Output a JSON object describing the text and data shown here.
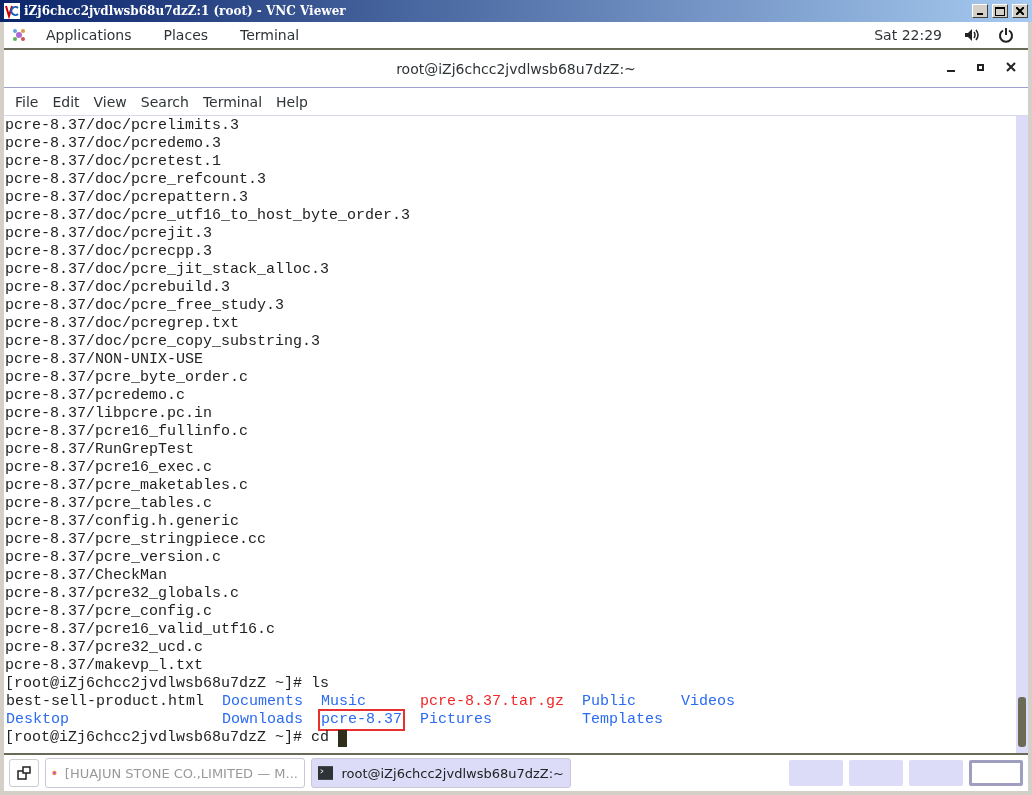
{
  "vnc_window": {
    "title": "iZj6chcc2jvdlwsb68u7dzZ:1 (root) - VNC Viewer"
  },
  "top_bar": {
    "menus": [
      "Applications",
      "Places",
      "Terminal"
    ],
    "clock": "Sat 22:29"
  },
  "terminal_window": {
    "title": "root@iZj6chcc2jvdlwsb68u7dzZ:~"
  },
  "menu_bar": [
    "File",
    "Edit",
    "View",
    "Search",
    "Terminal",
    "Help"
  ],
  "output_lines": [
    "pcre-8.37/doc/pcrelimits.3",
    "pcre-8.37/doc/pcredemo.3",
    "pcre-8.37/doc/pcretest.1",
    "pcre-8.37/doc/pcre_refcount.3",
    "pcre-8.37/doc/pcrepattern.3",
    "pcre-8.37/doc/pcre_utf16_to_host_byte_order.3",
    "pcre-8.37/doc/pcrejit.3",
    "pcre-8.37/doc/pcrecpp.3",
    "pcre-8.37/doc/pcre_jit_stack_alloc.3",
    "pcre-8.37/doc/pcrebuild.3",
    "pcre-8.37/doc/pcre_free_study.3",
    "pcre-8.37/doc/pcregrep.txt",
    "pcre-8.37/doc/pcre_copy_substring.3",
    "pcre-8.37/NON-UNIX-USE",
    "pcre-8.37/pcre_byte_order.c",
    "pcre-8.37/pcredemo.c",
    "pcre-8.37/libpcre.pc.in",
    "pcre-8.37/pcre16_fullinfo.c",
    "pcre-8.37/RunGrepTest",
    "pcre-8.37/pcre16_exec.c",
    "pcre-8.37/pcre_maketables.c",
    "pcre-8.37/pcre_tables.c",
    "pcre-8.37/config.h.generic",
    "pcre-8.37/pcre_stringpiece.cc",
    "pcre-8.37/pcre_version.c",
    "pcre-8.37/CheckMan",
    "pcre-8.37/pcre32_globals.c",
    "pcre-8.37/pcre_config.c",
    "pcre-8.37/pcre16_valid_utf16.c",
    "pcre-8.37/pcre32_ucd.c",
    "pcre-8.37/makevp_l.txt"
  ],
  "prompt_ls": "[root@iZj6chcc2jvdlwsb68u7dzZ ~]# ls",
  "ls_columns": [
    {
      "entries": [
        {
          "name": "best-sell-product.html",
          "kind": "file",
          "highlighted": false
        },
        {
          "name": "Desktop",
          "kind": "dir",
          "highlighted": false
        }
      ]
    },
    {
      "entries": [
        {
          "name": "Documents",
          "kind": "dir",
          "highlighted": false
        },
        {
          "name": "Downloads",
          "kind": "dir",
          "highlighted": false
        }
      ]
    },
    {
      "entries": [
        {
          "name": "Music",
          "kind": "dir",
          "highlighted": false
        },
        {
          "name": "pcre-8.37",
          "kind": "dir",
          "highlighted": true
        }
      ]
    },
    {
      "entries": [
        {
          "name": "pcre-8.37.tar.gz",
          "kind": "archive",
          "highlighted": false
        },
        {
          "name": "Pictures",
          "kind": "dir",
          "highlighted": false
        }
      ]
    },
    {
      "entries": [
        {
          "name": "Public",
          "kind": "dir",
          "highlighted": false
        },
        {
          "name": "Templates",
          "kind": "dir",
          "highlighted": false
        }
      ]
    },
    {
      "entries": [
        {
          "name": "Videos",
          "kind": "dir",
          "highlighted": false
        }
      ]
    }
  ],
  "prompt_current": "[root@iZj6chcc2jvdlwsb68u7dzZ ~]# cd",
  "taskbar": {
    "tasks": [
      {
        "label": "[HUAJUN STONE CO.,LIMITED — M...",
        "kind": "browser",
        "selected": false
      },
      {
        "label": "root@iZj6chcc2jvdlwsb68u7dzZ:~",
        "kind": "terminal",
        "selected": true
      }
    ],
    "workspaces": [
      {
        "selected": false
      },
      {
        "selected": false
      },
      {
        "selected": false
      },
      {
        "selected": true
      }
    ]
  }
}
